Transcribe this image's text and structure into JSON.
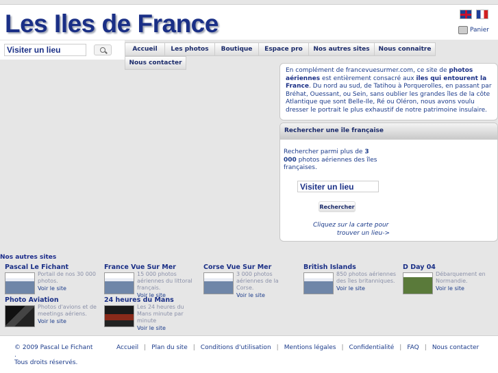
{
  "header": {
    "title": "Les Iles de France",
    "cart_label": "Panier"
  },
  "search": {
    "value": "Visiter un lieu"
  },
  "nav": {
    "items": [
      "Accueil",
      "Les photos",
      "Boutique",
      "Espace pro",
      "Nos autres sites",
      "Nous connaitre"
    ],
    "contact": "Nous contacter"
  },
  "intro": {
    "p1": "En complément de francevuesurmer.com, ce site de ",
    "p1_bold": "photos aériennes",
    "p2": " est entièrement consacré aux ",
    "p2_bold": "iles qui entourent la France",
    "p3": ". Du nord au sud, de Tatihou à Porquerolles, en passant par Bréhat, Ouessant, ou Sein, sans oublier les grandes îles de la côte Atlantique que sont Belle-Ile, Ré ou Oléron, nous avons voulu dresser le portrait le plus exhaustif de notre patrimoine insulaire."
  },
  "finder": {
    "title": "Rechercher une île française",
    "text_before": "Rechercher parmi plus de ",
    "text_bold": "3 000",
    "text_after": " photos aériennes des îles françaises.",
    "input_value": "Visiter un lieu",
    "button": "Rechercher",
    "map_link_1": "Cliquez sur la carte pour",
    "map_link_2": "trouver un lieu->"
  },
  "others": {
    "title": "Nos autres sites",
    "visit_label": "Voir le site",
    "sites": [
      {
        "name": "Pascal Le Fichant",
        "desc": "Portail de nos 30 000 photos."
      },
      {
        "name": "France Vue Sur Mer",
        "desc": "15 000 photos aériennes du littoral français."
      },
      {
        "name": "Corse Vue Sur Mer",
        "desc": "3 000 photos aériennes de la Corse."
      },
      {
        "name": "British Islands",
        "desc": "850 photos aériennes des îles britanniques."
      },
      {
        "name": "D Day 04",
        "desc": "Débarquement en Normandie."
      },
      {
        "name": "Photo Aviation",
        "desc": "Photos d'avions et de meetings aériens."
      },
      {
        "name": "24 heures du Mans",
        "desc": "Les 24 heures du Mans minute par minute"
      }
    ]
  },
  "footer": {
    "copyright_1": "© 2009 Pascal Le Fichant .",
    "copyright_2": "Tous droits réservés.",
    "links": [
      "Accueil",
      "Plan du site",
      "Conditions d'utilisation",
      "Mentions légales",
      "Confidentialité",
      "FAQ",
      "Nous contacter"
    ],
    "separator": "|"
  }
}
